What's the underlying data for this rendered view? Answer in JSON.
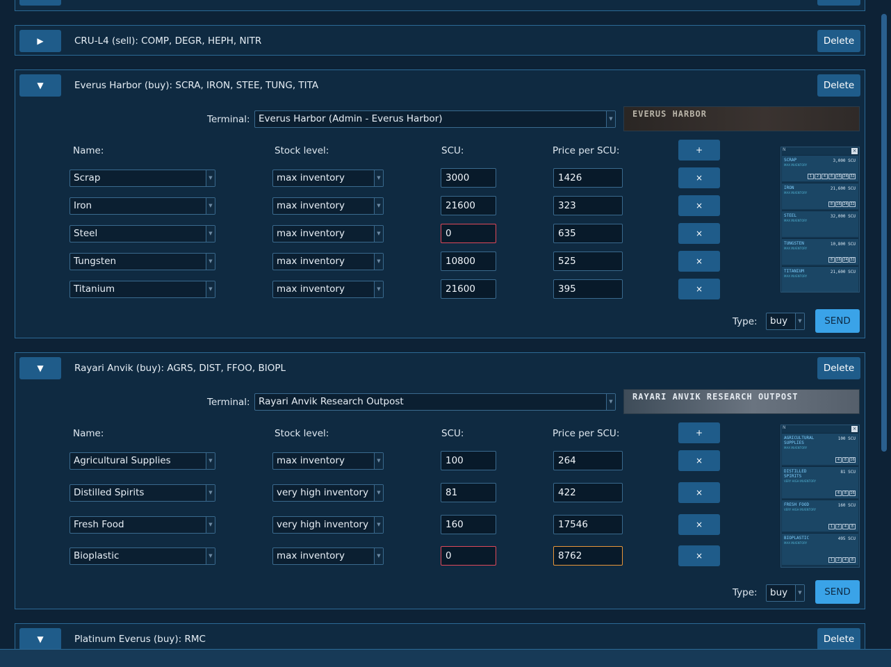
{
  "panels": {
    "cru": {
      "toggle": "▶",
      "title": "CRU-L4 (sell): COMP, DEGR, HEPH, NITR",
      "delete": "Delete"
    },
    "everus": {
      "toggle": "▼",
      "title": "Everus Harbor (buy): SCRA, IRON, STEE, TUNG, TITA",
      "delete": "Delete",
      "terminal_label": "Terminal:",
      "terminal_value": "Everus Harbor (Admin - Everus Harbor)",
      "banner_text": "EVERUS HARBOR",
      "headers": {
        "name": "Name:",
        "stock": "Stock level:",
        "scu": "SCU:",
        "price": "Price per SCU:"
      },
      "add_label": "+",
      "rows": [
        {
          "name": "Scrap",
          "stock": "max inventory",
          "scu": "3000",
          "price": "1426"
        },
        {
          "name": "Iron",
          "stock": "max inventory",
          "scu": "21600",
          "price": "323"
        },
        {
          "name": "Steel",
          "stock": "max inventory",
          "scu": "0",
          "price": "635"
        },
        {
          "name": "Tungsten",
          "stock": "max inventory",
          "scu": "10800",
          "price": "525"
        },
        {
          "name": "Titanium",
          "stock": "max inventory",
          "scu": "21600",
          "price": "395"
        }
      ],
      "remove_label": "×",
      "type_label": "Type:",
      "type_value": "buy",
      "send": "SEND"
    },
    "rayari": {
      "toggle": "▼",
      "title": "Rayari Anvik (buy): AGRS, DIST, FFOO, BIOPL",
      "delete": "Delete",
      "terminal_label": "Terminal:",
      "terminal_value": "Rayari Anvik Research Outpost",
      "banner_text": "RAYARI ANVIK RESEARCH OUTPOST",
      "headers": {
        "name": "Name:",
        "stock": "Stock level:",
        "scu": "SCU:",
        "price": "Price per SCU:"
      },
      "add_label": "+",
      "rows": [
        {
          "name": "Agricultural Supplies",
          "stock": "max inventory",
          "scu": "100",
          "price": "264"
        },
        {
          "name": "Distilled Spirits",
          "stock": "very high inventory",
          "scu": "81",
          "price": "422"
        },
        {
          "name": "Fresh Food",
          "stock": "very high inventory",
          "scu": "160",
          "price": "17546"
        },
        {
          "name": "Bioplastic",
          "stock": "max inventory",
          "scu": "0",
          "price": "8762"
        }
      ],
      "remove_label": "×",
      "type_label": "Type:",
      "type_value": "buy",
      "send": "SEND"
    },
    "platinum": {
      "toggle": "▼",
      "title": "Platinum Everus (buy): RMC",
      "delete": "Delete"
    }
  },
  "screenshot_everus": {
    "items": [
      {
        "name": "SCRAP",
        "sub": "MAX INVENTORY",
        "qty": "3,000 SCU",
        "boxes": [
          "1",
          "2",
          "4",
          "8",
          "16",
          "24",
          "32"
        ]
      },
      {
        "name": "IRON",
        "sub": "MAX INVENTORY",
        "qty": "21,600 SCU",
        "boxes": [
          "8",
          "16",
          "24",
          "32"
        ]
      },
      {
        "name": "STEEL",
        "sub": "MAX INVENTORY",
        "qty": "32,000 SCU",
        "boxes": []
      },
      {
        "name": "TUNGSTEN",
        "sub": "MAX INVENTORY",
        "qty": "10,800 SCU",
        "boxes": [
          "8",
          "16",
          "24",
          "32"
        ]
      },
      {
        "name": "TITANIUM",
        "sub": "MAX INVENTORY",
        "qty": "21,600 SCU",
        "boxes": []
      }
    ]
  },
  "screenshot_rayari": {
    "items": [
      {
        "name": "AGRICULTURAL SUPPLIES",
        "sub": "MAX INVENTORY",
        "qty": "100 SCU",
        "boxes": [
          "4",
          "8",
          "16"
        ]
      },
      {
        "name": "DISTILLED SPIRITS",
        "sub": "VERY HIGH INVENTORY",
        "qty": "81 SCU",
        "boxes": [
          "4",
          "8",
          "16"
        ]
      },
      {
        "name": "FRESH FOOD",
        "sub": "VERY HIGH INVENTORY",
        "qty": "160 SCU",
        "boxes": [
          "1",
          "2",
          "4",
          "8"
        ]
      },
      {
        "name": "BIOPLASTIC",
        "sub": "MAX INVENTORY",
        "qty": "495 SCU",
        "boxes": [
          "1",
          "2",
          "4",
          "8"
        ]
      }
    ]
  },
  "colors": {
    "background": "#0d2236",
    "panel": "#0f2a41",
    "border": "#2c6a96",
    "button": "#1f5c8a",
    "send": "#3aa3e8",
    "error": "#e0495a",
    "warning": "#e8963a",
    "everus_banner_text": "#b9b4a8",
    "rayari_banner_text": "#e4eaf0"
  },
  "icons": {
    "collapsed": "play-triangle-icon",
    "expanded": "triangle-down-icon",
    "remove": "close-icon",
    "add": "plus-icon"
  }
}
